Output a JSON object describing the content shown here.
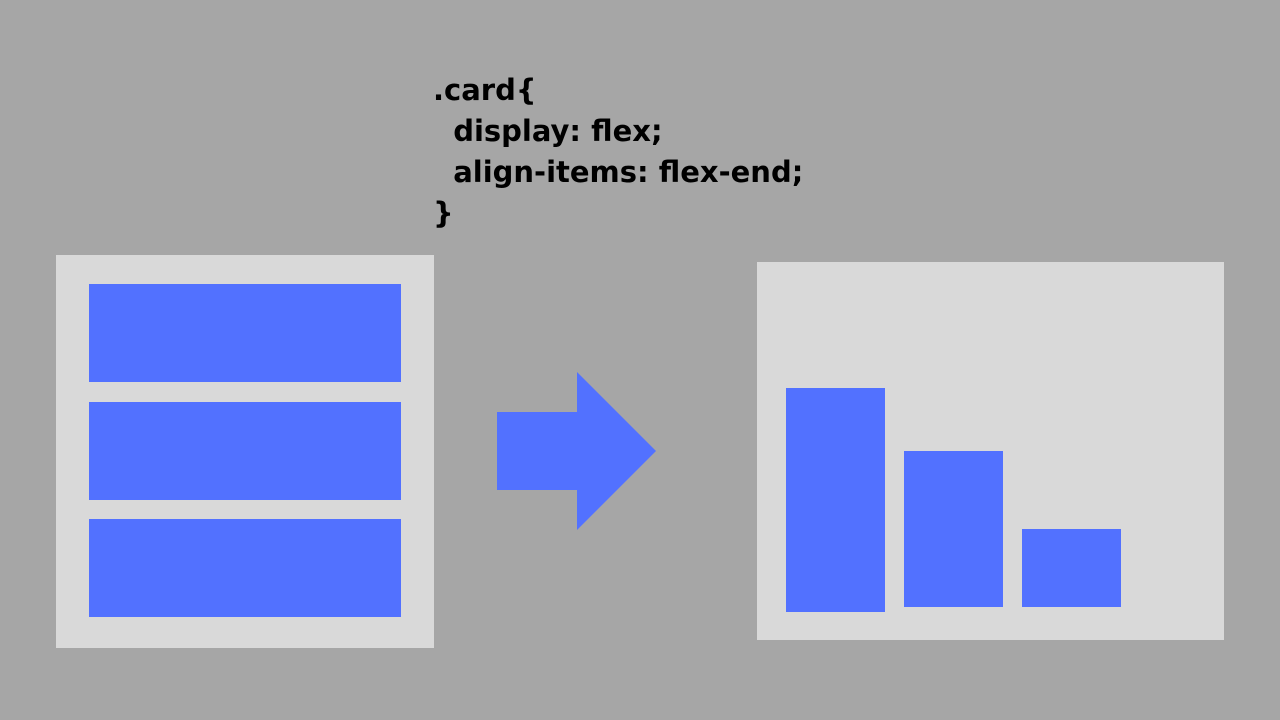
{
  "code": {
    "lines": [
      ".card{",
      "  display: flex;",
      "  align-items: flex-end;",
      "}"
    ]
  },
  "colors": {
    "background": "#a6a6a6",
    "card": "#d9d9d9",
    "box": "#5271ff",
    "text": "#000000"
  },
  "icons": {
    "arrow": "right-arrow-icon"
  }
}
